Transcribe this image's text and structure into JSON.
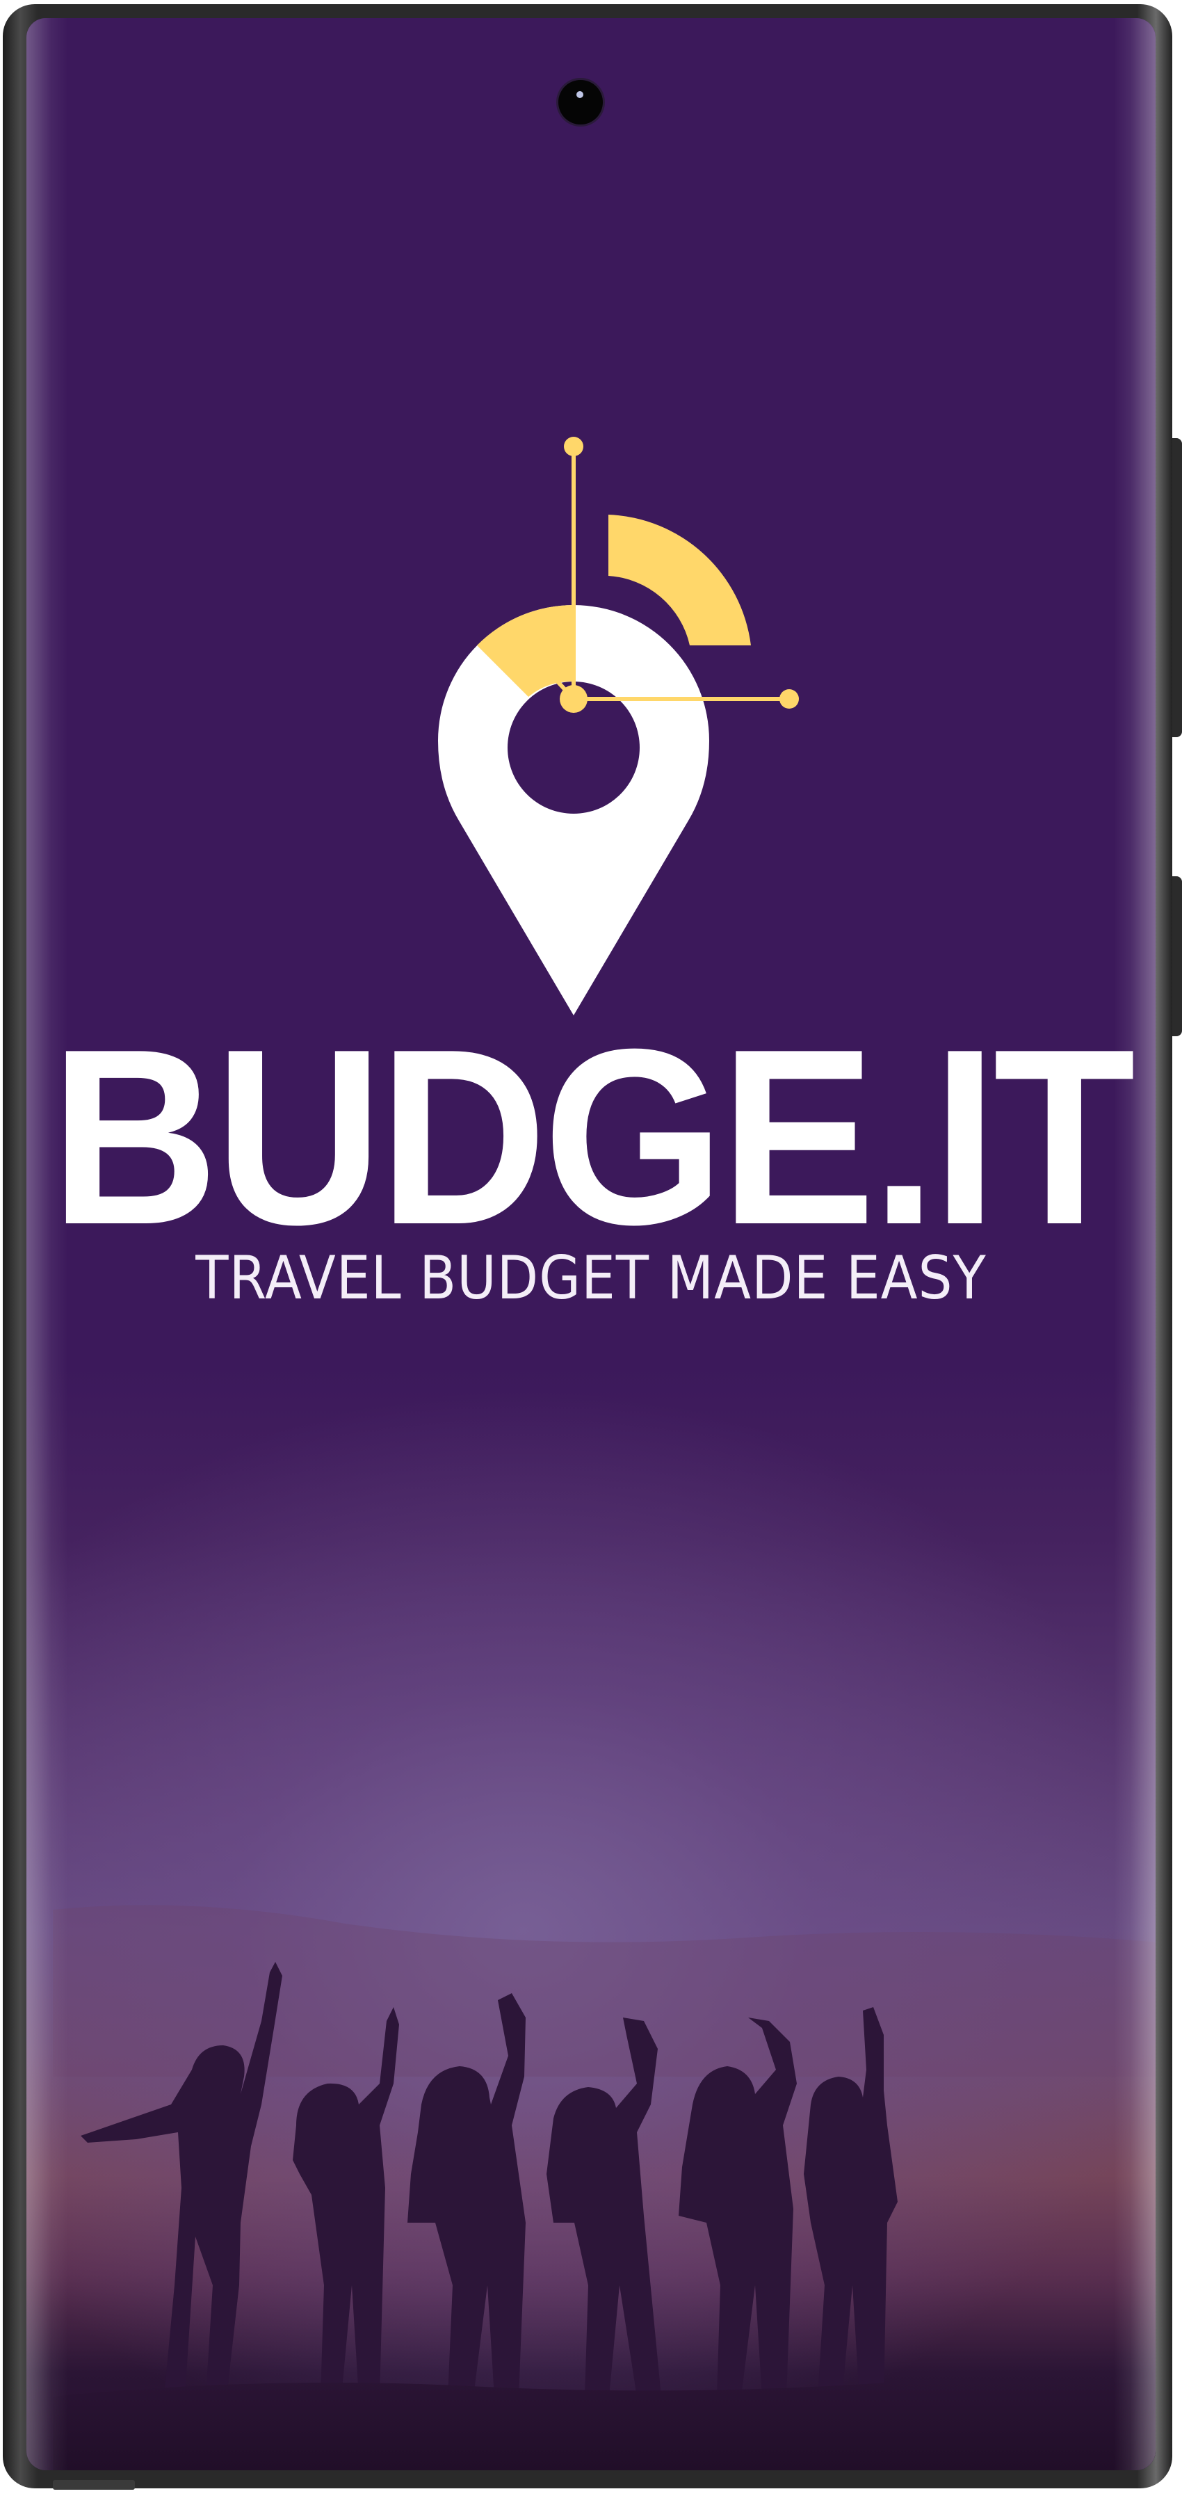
{
  "app": {
    "name": "BUDGE.IT",
    "tagline": "TRAVEL BUDGET MADE EASY"
  },
  "colors": {
    "background": "#3d1a5b",
    "accent": "#ffd76a",
    "pin": "#ffffff"
  },
  "icons": {
    "logo": "map-pin-chart-icon",
    "camera": "front-camera-icon"
  }
}
